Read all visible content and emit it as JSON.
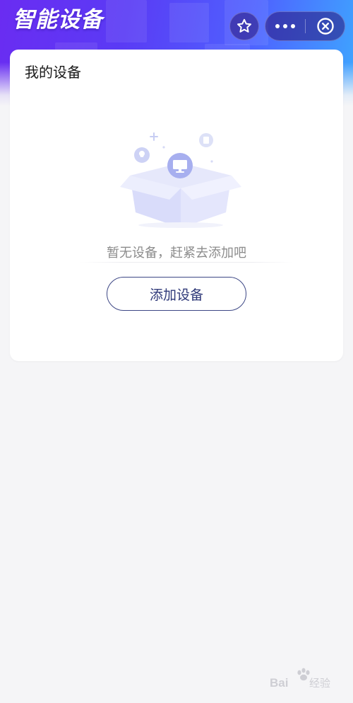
{
  "header": {
    "title": "智能设备",
    "favorite_icon": "star-icon",
    "more_icon": "more-dots-icon",
    "close_icon": "close-circle-icon",
    "colors": {
      "gradient_start": "#6a2cf2",
      "gradient_mid": "#4e63ff",
      "gradient_end": "#3ea6ff"
    }
  },
  "card": {
    "title": "我的设备",
    "empty_icon": "empty-box-icon",
    "empty_message": "暂无设备，赶紧去添加吧",
    "add_button_label": "添加设备"
  },
  "watermark": {
    "icon": "baidu-paw-logo",
    "text": "Bai 经验"
  }
}
